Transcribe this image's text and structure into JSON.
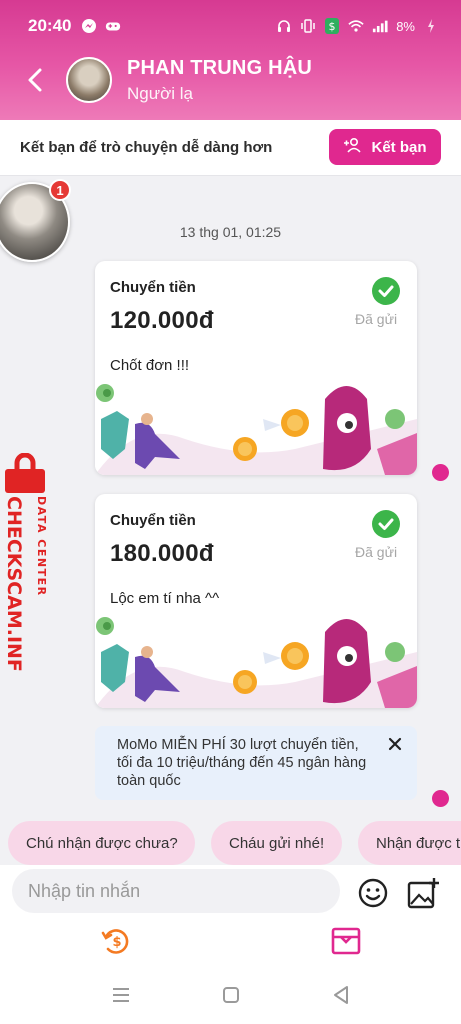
{
  "status_bar": {
    "time": "20:40",
    "battery": "8%"
  },
  "header": {
    "contact_name": "PHAN TRUNG HẬU",
    "contact_status": "Người lạ"
  },
  "friend_bar": {
    "prompt": "Kết bạn để trò chuyện dễ dàng hơn",
    "button_label": "Kết bạn"
  },
  "chat": {
    "timestamp": "13 thg 01, 01:25",
    "unread_badge": "1",
    "transfers": [
      {
        "title": "Chuyển tiền",
        "amount": "120.000đ",
        "status": "Đã gửi",
        "message": "Chốt đơn !!!"
      },
      {
        "title": "Chuyển tiền",
        "amount": "180.000đ",
        "status": "Đã gửi",
        "message": "Lộc em tí nha ^^"
      }
    ],
    "promo": {
      "text": "MoMo MIỄN PHÍ 30 lượt chuyển tiền, tối đa 10 triệu/tháng đến 45 ngân hàng toàn quốc"
    }
  },
  "suggestions": [
    "Chú nhận được chưa?",
    "Cháu gửi nhé!",
    "Nhận được t"
  ],
  "composer": {
    "placeholder": "Nhập tin nhắn"
  },
  "watermark": {
    "top": "DATA CENTER",
    "bottom": "CHECKSCAM.INFO"
  },
  "colors": {
    "brand_pink": "#e0288f",
    "success_green": "#3cb54a",
    "suggestion_bg": "#f8d7e8",
    "promo_bg": "#e8f0fb"
  },
  "icons": [
    "messenger-icon",
    "gamepad-icon",
    "headset-icon",
    "vibrate-icon",
    "dollar-shield-icon",
    "wifi-icon",
    "signal-icon",
    "battery-icon",
    "back-arrow-icon",
    "add-friend-icon",
    "check-icon",
    "close-icon",
    "emoji-icon",
    "add-image-icon",
    "transfer-money-icon",
    "gift-box-icon",
    "menu-nav-icon",
    "home-nav-icon",
    "back-nav-icon",
    "lock-icon"
  ]
}
